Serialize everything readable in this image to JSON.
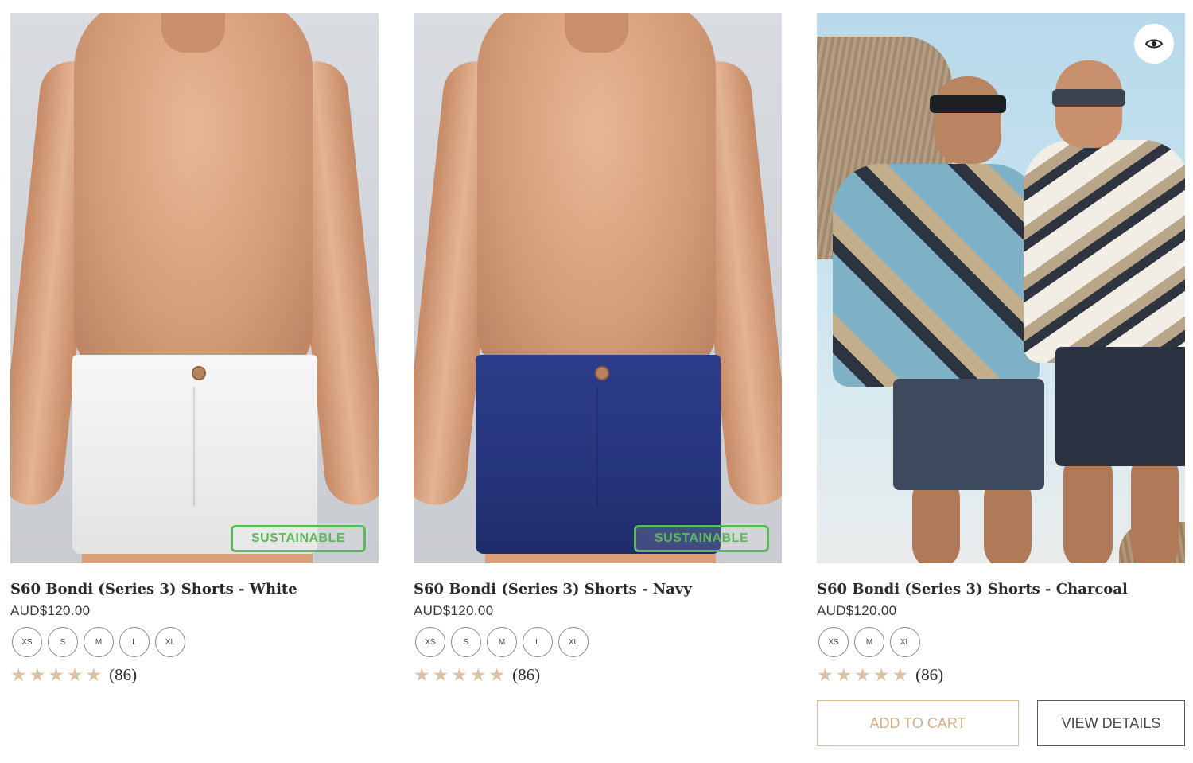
{
  "products": [
    {
      "title": "S60 Bondi (Series 3) Shorts - White",
      "price": "AUD$120.00",
      "badge": "SUSTAINABLE",
      "sizes": [
        "XS",
        "S",
        "M",
        "L",
        "XL"
      ],
      "rating_stars": 5,
      "review_count": "(86)",
      "shorts_color": "#f2f2f2"
    },
    {
      "title": "S60 Bondi (Series 3) Shorts - Navy",
      "price": "AUD$120.00",
      "badge": "SUSTAINABLE",
      "sizes": [
        "XS",
        "S",
        "M",
        "L",
        "XL"
      ],
      "rating_stars": 5,
      "review_count": "(86)",
      "shorts_color": "#26357c"
    },
    {
      "title": "S60 Bondi (Series 3) Shorts - Charcoal",
      "price": "AUD$120.00",
      "sizes": [
        "XS",
        "M",
        "XL"
      ],
      "rating_stars": 5,
      "review_count": "(86)",
      "quick_view_icon": "eye-icon",
      "add_to_cart_label": "ADD TO CART",
      "view_details_label": "VIEW DETAILS"
    }
  ],
  "colors": {
    "star": "#dcc1a3",
    "badge": "#5cb85c",
    "add_to_cart": "#d2b08a"
  }
}
